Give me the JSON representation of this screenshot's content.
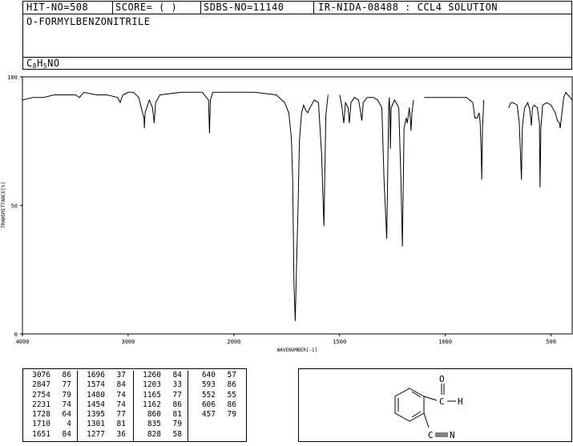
{
  "header": {
    "hit_no": "HIT-NO=508",
    "score": "SCORE=  (   )",
    "sdbs_no": "SDBS-NO=11140",
    "ir_code": "IR-NIDA-08488 : CCL4 SOLUTION",
    "compound_name": "O-FORMYLBENZONITRILE",
    "formula": {
      "c": "C",
      "c_n": "8",
      "h": "H",
      "h_n": "5",
      "rest": "NO"
    }
  },
  "chart_data": {
    "type": "line",
    "xlabel": "WAVENUMBER[-1]",
    "ylabel": "TRANSMITTANCE[%]",
    "xlim": [
      4000,
      400
    ],
    "ylim": [
      0,
      100
    ],
    "x_ticks": [
      "4000",
      "3000",
      "2000",
      "1500",
      "1000",
      "500"
    ],
    "y_ticks": [
      "0",
      "50",
      "100"
    ],
    "series": [
      {
        "segments": [
          [
            [
              4000,
              91
            ],
            [
              3900,
              92
            ],
            [
              3800,
              92
            ],
            [
              3700,
              93
            ],
            [
              3600,
              93
            ],
            [
              3500,
              93
            ],
            [
              3460,
              92
            ],
            [
              3420,
              94
            ],
            [
              3300,
              93
            ],
            [
              3200,
              93
            ],
            [
              3100,
              92
            ],
            [
              3076,
              90
            ],
            [
              3050,
              93
            ],
            [
              3000,
              94
            ],
            [
              2950,
              94
            ],
            [
              2900,
              92
            ],
            [
              2870,
              87
            ],
            [
              2850,
              84
            ],
            [
              2847,
              80
            ],
            [
              2840,
              86
            ],
            [
              2800,
              91
            ],
            [
              2770,
              88
            ],
            [
              2754,
              82
            ],
            [
              2740,
              90
            ],
            [
              2700,
              93
            ],
            [
              2500,
              94
            ],
            [
              2300,
              94
            ],
            [
              2240,
              91
            ],
            [
              2231,
              78
            ],
            [
              2222,
              91
            ],
            [
              2200,
              94
            ],
            [
              2000,
              94
            ],
            [
              1900,
              94
            ],
            [
              1800,
              93
            ],
            [
              1760,
              90
            ],
            [
              1740,
              86
            ],
            [
              1728,
              76
            ],
            [
              1722,
              60
            ],
            [
              1716,
              20
            ],
            [
              1710,
              5
            ],
            [
              1704,
              25
            ],
            [
              1696,
              50
            ],
            [
              1690,
              75
            ],
            [
              1680,
              86
            ],
            [
              1670,
              89
            ],
            [
              1660,
              87
            ],
            [
              1651,
              86
            ],
            [
              1640,
              88
            ],
            [
              1620,
              91
            ],
            [
              1600,
              90
            ],
            [
              1585,
              70
            ],
            [
              1574,
              42
            ],
            [
              1565,
              85
            ],
            [
              1555,
              93
            ]
          ],
          [
            [
              1500,
              93
            ],
            [
              1490,
              89
            ],
            [
              1480,
              82
            ],
            [
              1472,
              90
            ],
            [
              1460,
              88
            ],
            [
              1454,
              82
            ],
            [
              1446,
              90
            ],
            [
              1430,
              92
            ],
            [
              1410,
              91
            ],
            [
              1400,
              86
            ],
            [
              1395,
              83
            ],
            [
              1388,
              90
            ],
            [
              1370,
              92
            ],
            [
              1340,
              92
            ],
            [
              1320,
              91
            ],
            [
              1300,
              88
            ],
            [
              1290,
              60
            ],
            [
              1277,
              37
            ],
            [
              1268,
              88
            ],
            [
              1265,
              92
            ],
            [
              1262,
              85
            ],
            [
              1260,
              72
            ],
            [
              1256,
              88
            ],
            [
              1240,
              91
            ],
            [
              1220,
              88
            ],
            [
              1210,
              60
            ],
            [
              1203,
              34
            ],
            [
              1195,
              80
            ],
            [
              1185,
              84
            ],
            [
              1180,
              82
            ],
            [
              1170,
              88
            ],
            [
              1165,
              83
            ],
            [
              1162,
              79
            ],
            [
              1158,
              86
            ],
            [
              1150,
              91
            ]
          ],
          [
            [
              1100,
              92
            ],
            [
              1000,
              92
            ],
            [
              900,
              92
            ],
            [
              870,
              90
            ],
            [
              860,
              84
            ],
            [
              850,
              84
            ],
            [
              840,
              86
            ],
            [
              835,
              82
            ],
            [
              830,
              70
            ],
            [
              828,
              60
            ],
            [
              824,
              80
            ],
            [
              818,
              91
            ]
          ],
          [
            [
              700,
              88
            ],
            [
              690,
              90
            ],
            [
              680,
              90
            ],
            [
              660,
              89
            ],
            [
              650,
              82
            ],
            [
              640,
              60
            ],
            [
              636,
              80
            ],
            [
              625,
              88
            ],
            [
              610,
              90
            ],
            [
              600,
              87
            ],
            [
              593,
              81
            ],
            [
              588,
              88
            ],
            [
              580,
              89
            ],
            [
              565,
              88
            ],
            [
              555,
              82
            ],
            [
              552,
              57
            ],
            [
              548,
              80
            ],
            [
              540,
              89
            ],
            [
              520,
              90
            ],
            [
              500,
              89
            ],
            [
              480,
              86
            ],
            [
              470,
              83
            ],
            [
              460,
              82
            ],
            [
              457,
              80
            ],
            [
              450,
              85
            ],
            [
              440,
              92
            ],
            [
              430,
              94
            ],
            [
              420,
              93
            ],
            [
              410,
              92
            ],
            [
              400,
              91
            ]
          ]
        ]
      }
    ]
  },
  "peaks": {
    "columns": [
      [
        [
          "3076",
          "86"
        ],
        [
          "2847",
          "77"
        ],
        [
          "2754",
          "79"
        ],
        [
          "2231",
          "74"
        ],
        [
          "1728",
          "64"
        ],
        [
          "1710",
          "4"
        ],
        [
          "1651",
          "84"
        ]
      ],
      [
        [
          "1696",
          "37"
        ],
        [
          "1574",
          "84"
        ],
        [
          "1480",
          "74"
        ],
        [
          "1454",
          "74"
        ],
        [
          "1395",
          "77"
        ],
        [
          "1301",
          "81"
        ],
        [
          "1277",
          "36"
        ]
      ],
      [
        [
          "1260",
          "84"
        ],
        [
          "1203",
          "33"
        ],
        [
          "1165",
          "77"
        ],
        [
          "1162",
          "86"
        ],
        [
          "860",
          "81"
        ],
        [
          "835",
          "79"
        ],
        [
          "828",
          "58"
        ]
      ],
      [
        [
          "640",
          "57"
        ],
        [
          "593",
          "86"
        ],
        [
          "552",
          "55"
        ],
        [
          "606",
          "86"
        ],
        [
          "457",
          "79"
        ]
      ]
    ]
  },
  "structure": {
    "aldehyde_o": "O",
    "aldehyde_c": "C",
    "aldehyde_h": "H",
    "nitrile_c": "C",
    "nitrile_n": "N"
  }
}
